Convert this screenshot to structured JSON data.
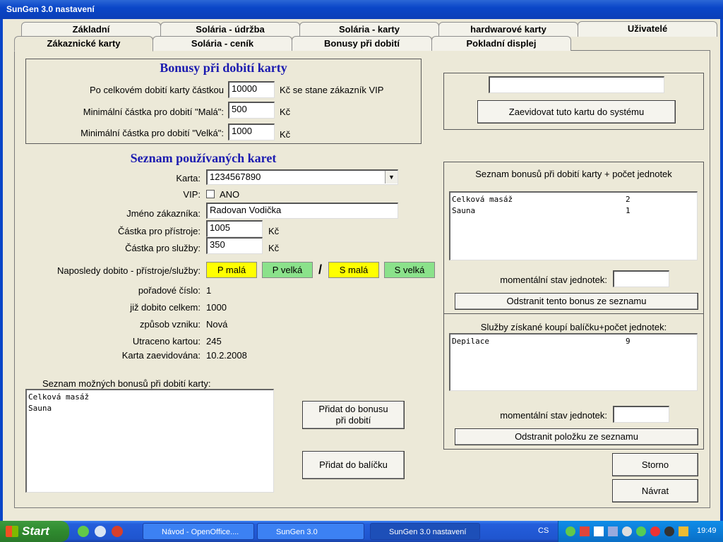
{
  "window": {
    "title": "SunGen 3.0 nastavení"
  },
  "tabs_top": [
    "Základní",
    "Solária - údržba",
    "Solária - karty",
    "hardwarové karty",
    "Uživatelé"
  ],
  "tabs_bottom": [
    "Zákaznické karty",
    "Solária - ceník",
    "Bonusy při dobití",
    "Pokladní displej"
  ],
  "bonus_section": {
    "heading": "Bonusy při dobití karty",
    "vip_label": "Po celkovém dobití karty částkou",
    "vip_value": "10000",
    "vip_suffix": "Kč se stane zákazník VIP",
    "small_label": "Minimální částka pro dobití \"Malá\":",
    "small_value": "500",
    "large_label": "Minimální částka pro dobití \"Velká\":",
    "large_value": "1000",
    "currency": "Kč"
  },
  "register": {
    "input_value": "",
    "button": "Zaevidovat tuto kartu do systému"
  },
  "cards_section": {
    "heading": "Seznam používaných karet",
    "card_label": "Karta:",
    "card_value": "1234567890",
    "vip_label": "VIP:",
    "vip_checkbox_label": "ANO",
    "vip_checked": false,
    "name_label": "Jméno zákazníka:",
    "name_value": "Radovan Vodička",
    "devices_label": "Částka pro přístroje:",
    "devices_value": "1005",
    "services_label": "Částka pro služby:",
    "services_value": "350",
    "currency": "Kč",
    "last_label": "Naposledy dobito - přístroje/služby:",
    "btn_p_mala": "P malá",
    "btn_p_velka": "P velká",
    "separator": "/",
    "btn_s_mala": "S malá",
    "btn_s_velka": "S velká",
    "color_yellow": "#ffff00",
    "color_green": "#8be28b",
    "order_label": "pořadové číslo:",
    "order_value": "1",
    "total_label": "již dobito celkem:",
    "total_value": "1000",
    "origin_label": "způsob vzniku:",
    "origin_value": "Nová",
    "spent_label": "Utraceno kartou:",
    "spent_value": "245",
    "registered_label": "Karta zaevidována:",
    "registered_value": "10.2.2008"
  },
  "possible_bonuses": {
    "label": "Seznam možných bonusů při dobití karty:",
    "items": [
      "Celková masáž",
      "Sauna"
    ],
    "add_bonus_button": "Přidat do bonusu\npři dobití",
    "add_package_button": "Přidat do balíčku"
  },
  "bonus_list": {
    "title": "Seznam bonusů při dobití karty + počet jednotek",
    "items": [
      {
        "name": "Celková masáž",
        "count": "2"
      },
      {
        "name": "Sauna",
        "count": "1"
      }
    ],
    "state_label": "momentální stav jednotek:",
    "state_value": "",
    "remove_button": "Odstranit tento bonus ze seznamu"
  },
  "package_list": {
    "title": "Služby získané koupí balíčku+počet jednotek:",
    "items": [
      {
        "name": "Depilace",
        "count": "9"
      }
    ],
    "state_label": "momentální stav jednotek:",
    "state_value": "",
    "remove_button": "Odstranit položku ze seznamu"
  },
  "actions": {
    "cancel": "Storno",
    "return": "Návrat"
  },
  "taskbar": {
    "start": "Start",
    "tasks": [
      "Návod - OpenOffice....",
      "SunGen 3.0",
      "SunGen 3.0 nastavení"
    ],
    "lang": "CS",
    "clock": "19:49"
  }
}
